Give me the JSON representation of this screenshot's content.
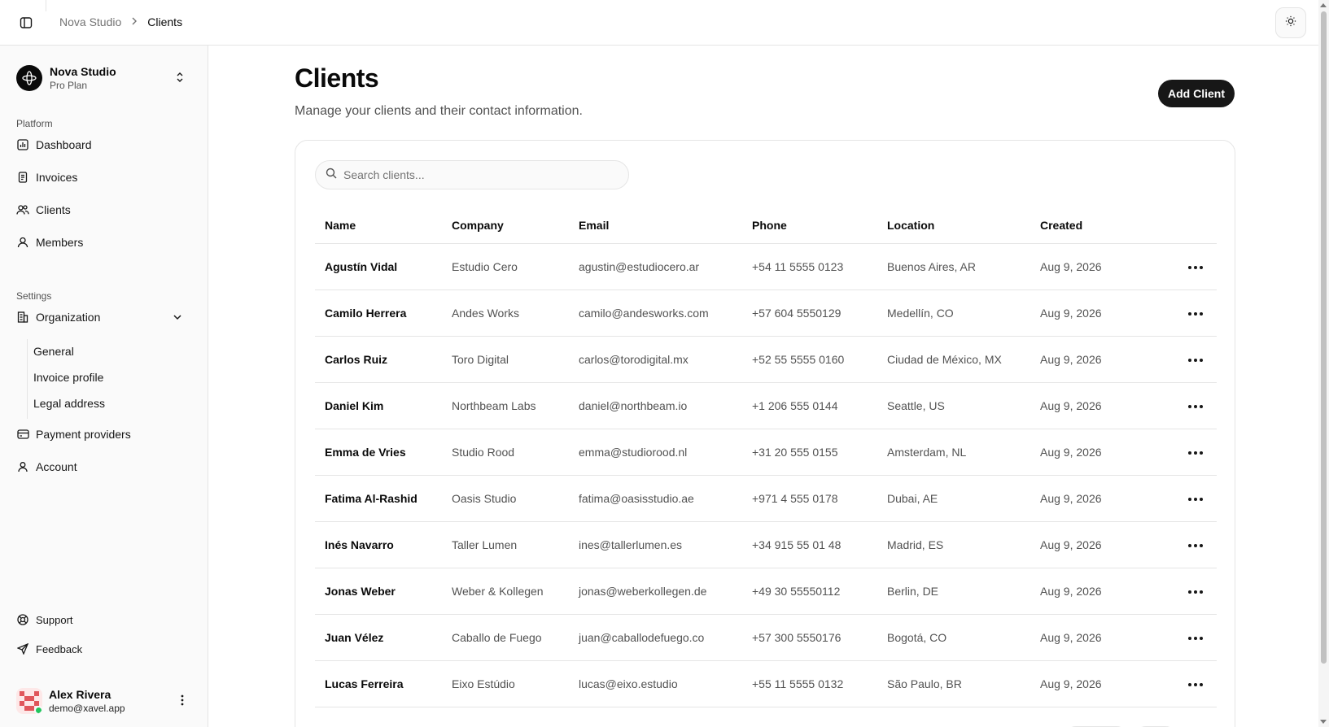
{
  "breadcrumb": {
    "root": "Nova Studio",
    "current": "Clients"
  },
  "org": {
    "name": "Nova Studio",
    "plan": "Pro Plan"
  },
  "sidebar": {
    "platform_label": "Platform",
    "platform_items": [
      {
        "label": "Dashboard",
        "icon": "chart-icon"
      },
      {
        "label": "Invoices",
        "icon": "invoice-icon"
      },
      {
        "label": "Clients",
        "icon": "users-icon"
      },
      {
        "label": "Members",
        "icon": "members-icon"
      }
    ],
    "settings_label": "Settings",
    "organization_label": "Organization",
    "organization_sub": [
      "General",
      "Invoice profile",
      "Legal address"
    ],
    "payment_label": "Payment providers",
    "account_label": "Account",
    "support_label": "Support",
    "feedback_label": "Feedback"
  },
  "user": {
    "name": "Alex Rivera",
    "email": "demo@xavel.app"
  },
  "page": {
    "title": "Clients",
    "subtitle": "Manage your clients and their contact information.",
    "add_button": "Add Client",
    "search_placeholder": "Search clients..."
  },
  "table": {
    "columns": [
      "Name",
      "Company",
      "Email",
      "Phone",
      "Location",
      "Created"
    ],
    "rows": [
      {
        "name": "Agustín Vidal",
        "company": "Estudio Cero",
        "email": "agustin@estudiocero.ar",
        "phone": "+54 11 5555 0123",
        "location": "Buenos Aires, AR",
        "created": "Aug 9, 2026"
      },
      {
        "name": "Camilo Herrera",
        "company": "Andes Works",
        "email": "camilo@andesworks.com",
        "phone": "+57 604 5550129",
        "location": "Medellín, CO",
        "created": "Aug 9, 2026"
      },
      {
        "name": "Carlos Ruiz",
        "company": "Toro Digital",
        "email": "carlos@torodigital.mx",
        "phone": "+52 55 5555 0160",
        "location": "Ciudad de México, MX",
        "created": "Aug 9, 2026"
      },
      {
        "name": "Daniel Kim",
        "company": "Northbeam Labs",
        "email": "daniel@northbeam.io",
        "phone": "+1 206 555 0144",
        "location": "Seattle, US",
        "created": "Aug 9, 2026"
      },
      {
        "name": "Emma de Vries",
        "company": "Studio Rood",
        "email": "emma@studiorood.nl",
        "phone": "+31 20 555 0155",
        "location": "Amsterdam, NL",
        "created": "Aug 9, 2026"
      },
      {
        "name": "Fatima Al-Rashid",
        "company": "Oasis Studio",
        "email": "fatima@oasisstudio.ae",
        "phone": "+971 4 555 0178",
        "location": "Dubai, AE",
        "created": "Aug 9, 2026"
      },
      {
        "name": "Inés Navarro",
        "company": "Taller Lumen",
        "email": "ines@tallerlumen.es",
        "phone": "+34 915 55 01 48",
        "location": "Madrid, ES",
        "created": "Aug 9, 2026"
      },
      {
        "name": "Jonas Weber",
        "company": "Weber & Kollegen",
        "email": "jonas@weberkollegen.de",
        "phone": "+49 30 55550112",
        "location": "Berlin, DE",
        "created": "Aug 9, 2026"
      },
      {
        "name": "Juan Vélez",
        "company": "Caballo de Fuego",
        "email": "juan@caballodefuego.co",
        "phone": "+57 300 5550176",
        "location": "Bogotá, CO",
        "created": "Aug 9, 2026"
      },
      {
        "name": "Lucas Ferreira",
        "company": "Eixo Estúdio",
        "email": "lucas@eixo.estudio",
        "phone": "+55 11 5555 0132",
        "location": "São Paulo, BR",
        "created": "Aug 9, 2026"
      }
    ]
  },
  "colors": {
    "primary": "#171717",
    "border": "#e5e5e5",
    "muted_text": "#525252",
    "sidebar_bg": "#fafafa",
    "online": "#22c55e"
  }
}
